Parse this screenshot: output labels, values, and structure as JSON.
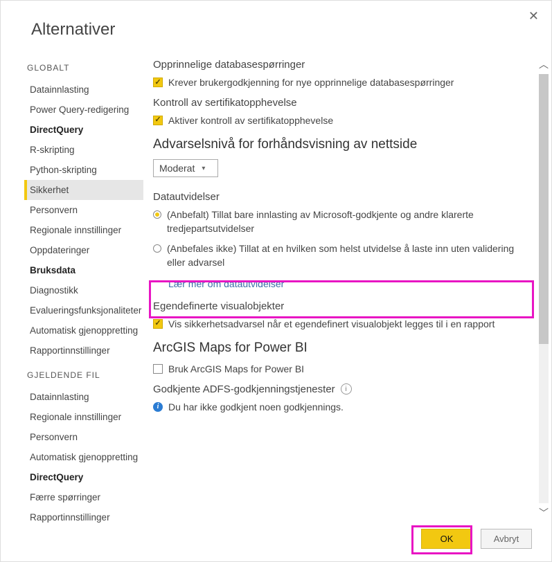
{
  "title": "Alternativer",
  "sidebar": {
    "globalHeader": "GLOBALT",
    "global": [
      {
        "label": "Datainnlasting",
        "bold": false,
        "active": false
      },
      {
        "label": "Power Query-redigering",
        "bold": false,
        "active": false
      },
      {
        "label": "DirectQuery",
        "bold": true,
        "active": false
      },
      {
        "label": "R-skripting",
        "bold": false,
        "active": false
      },
      {
        "label": "Python-skripting",
        "bold": false,
        "active": false
      },
      {
        "label": "Sikkerhet",
        "bold": false,
        "active": true
      },
      {
        "label": "Personvern",
        "bold": false,
        "active": false
      },
      {
        "label": "Regionale innstillinger",
        "bold": false,
        "active": false
      },
      {
        "label": "Oppdateringer",
        "bold": false,
        "active": false
      },
      {
        "label": "Bruksdata",
        "bold": true,
        "active": false
      },
      {
        "label": "Diagnostikk",
        "bold": false,
        "active": false
      },
      {
        "label": "Evalueringsfunksjonaliteter",
        "bold": false,
        "active": false
      },
      {
        "label": "Automatisk gjenoppretting",
        "bold": false,
        "active": false
      },
      {
        "label": "Rapportinnstillinger",
        "bold": false,
        "active": false
      }
    ],
    "currentHeader": "GJELDENDE FIL",
    "current": [
      {
        "label": "Datainnlasting",
        "bold": false,
        "active": false
      },
      {
        "label": "Regionale innstillinger",
        "bold": false,
        "active": false
      },
      {
        "label": "Personvern",
        "bold": false,
        "active": false
      },
      {
        "label": "Automatisk gjenoppretting",
        "bold": false,
        "active": false
      },
      {
        "label": "DirectQuery",
        "bold": true,
        "active": false
      },
      {
        "label": "Færre spørringer",
        "bold": false,
        "active": false
      },
      {
        "label": "Rapportinnstillinger",
        "bold": false,
        "active": false
      }
    ]
  },
  "content": {
    "nativeQueriesHeader": "Opprinnelige  databasespørringer",
    "nativeQueriesCheck": "Krever brukergodkjenning for nye opprinnelige databasespørringer",
    "certRevHeader": "Kontroll  av  sertifikatopphevelse",
    "certRevCheck": "Aktiver kontroll av sertifikatopphevelse",
    "previewHeader": "Advarselsnivå for forhåndsvisning av nettside",
    "previewSelected": "Moderat",
    "extHeader": "Datautvidelser",
    "extRadio1": "(Anbefalt) Tillat bare innlasting av Microsoft-godkjente og andre klarerte tredjepartsutvidelser",
    "extRadio2": "(Anbefales ikke) Tillat at en hvilken som helst utvidelse å laste inn uten validering eller advarsel",
    "extLink": "Lær mer om datautvidelser",
    "customVisHeader": "Egendefinerte visualobjekter",
    "customVisCheck": "Vis sikkerhetsadvarsel når et egendefinert visualobjekt legges til i en rapport",
    "arcgisHeader": "ArcGIS Maps for Power BI",
    "arcgisCheck": "Bruk ArcGIS Maps for Power BI",
    "adfsHeader": "Godkjente ADFS-godkjenningstjenester",
    "adfsInfo": "Du har ikke godkjent noen godkjennings."
  },
  "footer": {
    "ok": "OK",
    "cancel": "Avbryt"
  }
}
